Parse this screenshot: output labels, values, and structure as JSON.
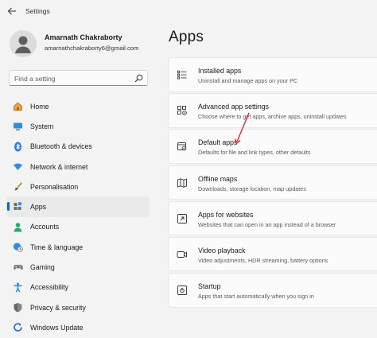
{
  "window": {
    "title": "Settings"
  },
  "user": {
    "name": "Amarnath Chakraborty",
    "email": "amarnathchakraborty6@gmail.com"
  },
  "search": {
    "placeholder": "Find a setting"
  },
  "nav": {
    "items": [
      {
        "label": "Home",
        "icon": "home-icon"
      },
      {
        "label": "System",
        "icon": "system-icon"
      },
      {
        "label": "Bluetooth & devices",
        "icon": "bluetooth-icon"
      },
      {
        "label": "Network & internet",
        "icon": "wifi-icon"
      },
      {
        "label": "Personalisation",
        "icon": "brush-icon"
      },
      {
        "label": "Apps",
        "icon": "apps-icon",
        "selected": true
      },
      {
        "label": "Accounts",
        "icon": "account-icon"
      },
      {
        "label": "Time & language",
        "icon": "globe-clock-icon"
      },
      {
        "label": "Gaming",
        "icon": "gamepad-icon"
      },
      {
        "label": "Accessibility",
        "icon": "accessibility-icon"
      },
      {
        "label": "Privacy & security",
        "icon": "shield-icon"
      },
      {
        "label": "Windows Update",
        "icon": "update-icon"
      }
    ]
  },
  "page": {
    "title": "Apps"
  },
  "cards": [
    {
      "title": "Installed apps",
      "desc": "Uninstall and manage apps on your PC",
      "icon": "installed-apps-icon"
    },
    {
      "title": "Advanced app settings",
      "desc": "Choose where to get apps, archive apps, uninstall updates",
      "icon": "advanced-app-settings-icon"
    },
    {
      "title": "Default apps",
      "desc": "Defaults for file and link types, other defaults",
      "icon": "default-apps-icon"
    },
    {
      "title": "Offline maps",
      "desc": "Downloads, storage location, map updates",
      "icon": "map-icon"
    },
    {
      "title": "Apps for websites",
      "desc": "Websites that can open in an app instead of a browser",
      "icon": "apps-for-websites-icon"
    },
    {
      "title": "Video playback",
      "desc": "Video adjustments, HDR streaming, battery options",
      "icon": "video-icon"
    },
    {
      "title": "Startup",
      "desc": "Apps that start automatically when you sign in",
      "icon": "startup-icon"
    }
  ],
  "colors": {
    "accent": "#0067c0",
    "annotation": "#d42a2a",
    "background": "#f3f3f3"
  }
}
